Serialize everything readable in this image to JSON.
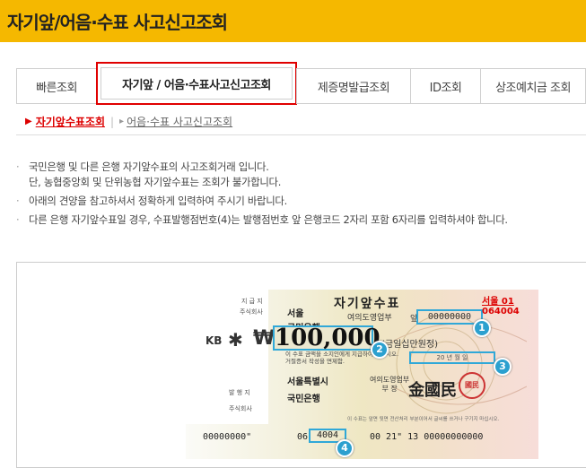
{
  "page": {
    "title": "자기앞/어음·수표 사고신고조회"
  },
  "tabs": [
    {
      "label": "빠른조회"
    },
    {
      "label": "자기앞 / 어음·수표사고신고조회"
    },
    {
      "label": "제증명발급조회"
    },
    {
      "label": "ID조회"
    },
    {
      "label": "상조예치금 조회"
    }
  ],
  "subtabs": {
    "active": "자기앞수표조회",
    "other": "어음·수표 사고신고조회"
  },
  "notes": {
    "line1": "국민은행 및 다른 은행 자기앞수표의 사고조회거래 입니다.",
    "line1b": "단, 농협중앙회 및 단위농협 자기앞수표는 조회가 불가합니다.",
    "line2": "아래의 견양을 참고하셔서 정확하게 입력하여 주시기 바랍니다.",
    "line3": "다른 은행 자기앞수표일 경우, 수표발행점번호(4)는 발행점번호 앞 은행코드 2자리 포함 6자리를 입력하셔야 합니다."
  },
  "cheque": {
    "title": "자기앞수표",
    "stub_label1": "지 급 지",
    "stub_label2": "주식회사",
    "region": "서울",
    "bank": "국민은행",
    "branch": "여의도영업부",
    "front_label": "앞",
    "serial": "00000000",
    "red_code_1": "서울 01",
    "red_code_2": "064004",
    "logo": "KB",
    "currency": "₩",
    "amount": "100,000",
    "amount_korean": "(금일십만원정)",
    "note_1": "이 수표 금액을 소지인에게 지급하여 주십시오.",
    "note_2": "거절증서 작성을 면제함.",
    "date": "20 년 월 일",
    "issue_label1": "발 행 지",
    "issue_label2": "주식회사",
    "issue_region": "서울특별시",
    "issue_bank": "국민은행",
    "issue_branch": "여의도영업부",
    "issue_branch2": "부 장",
    "manager": "金國民",
    "seal": "國民",
    "fineprint": "이 수표는 앞면 뒷면 전산처리 부분이어서 글씨를 쓰거나 구기지 마십시오.",
    "micr_a": "00000000\"",
    "micr_b": "06",
    "micr_box": "4004",
    "micr_c": "00 21\"  13  00000000000",
    "markers": [
      "1",
      "2",
      "3",
      "4"
    ]
  }
}
